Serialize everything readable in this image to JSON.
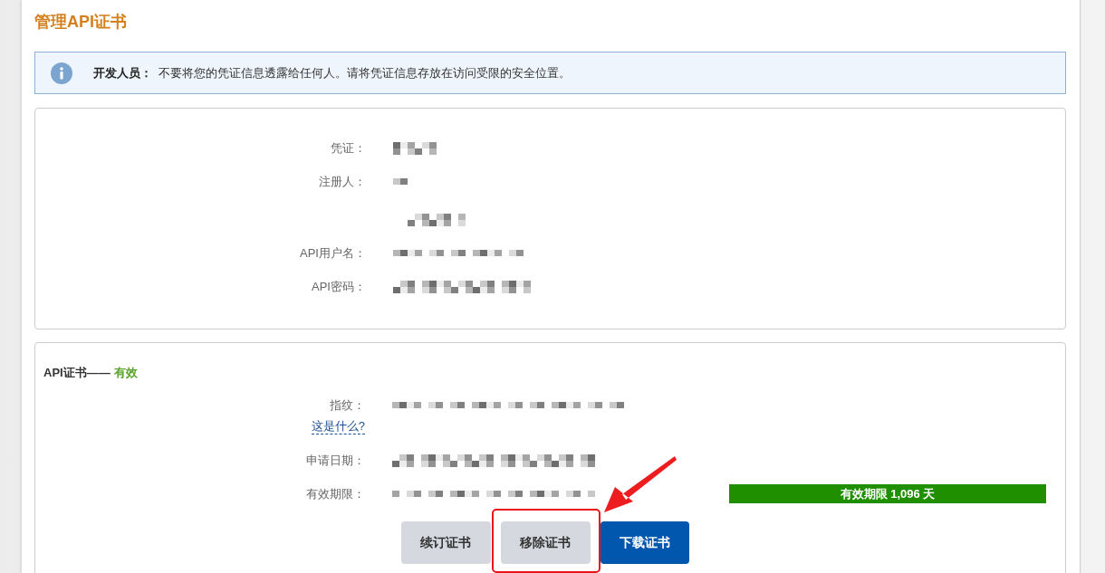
{
  "page": {
    "title": "管理API证书"
  },
  "notice": {
    "text": "**开发人员：**  不要将您的凭证信息透露给任何人。请将凭证信息存放在访问受限的安全位置。"
  },
  "credentials": {
    "fields": [
      {
        "label": "凭证：",
        "masked": true
      },
      {
        "label": "注册人：",
        "masked": true
      },
      {
        "masked": true
      },
      {
        "label": "API用户名：",
        "masked": true
      },
      {
        "label": "API密码：",
        "masked": true
      }
    ]
  },
  "certificate": {
    "heading": "API证书——",
    "status": {
      "text": "有效",
      "kind": "valid"
    },
    "fields": [
      {
        "label": "指纹：",
        "masked": true,
        "help_link": "这是什么?"
      },
      {
        "label": "申请日期：",
        "masked": true
      },
      {
        "label": "有效期限：",
        "masked": true,
        "badge": "有效期限 1,096 天"
      }
    ],
    "buttons": [
      {
        "label": "续订证书",
        "kind": "secondary",
        "highlighted": false
      },
      {
        "label": "移除证书",
        "kind": "secondary",
        "highlighted": true
      },
      {
        "label": "下载证书",
        "kind": "primary",
        "highlighted": false
      }
    ]
  }
}
